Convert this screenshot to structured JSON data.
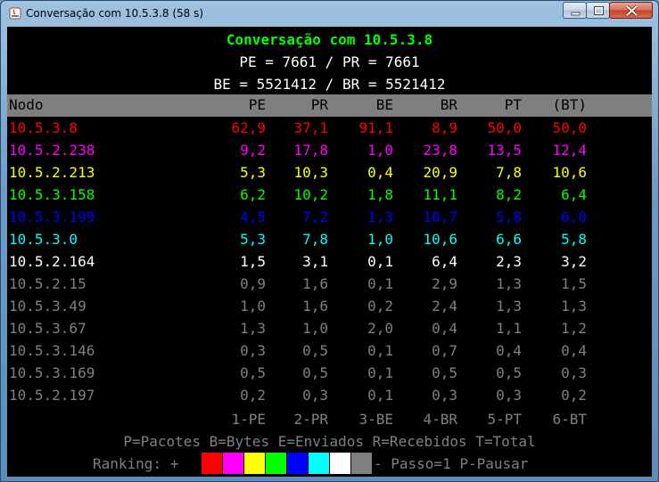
{
  "window": {
    "title": "Conversação com 10.5.3.8 (58 s)"
  },
  "summary": {
    "heading": "Conversação com 10.5.3.8",
    "packets_line": "PE = 7661 / PR = 7661",
    "bytes_line": "BE = 5521412 / BR = 5521412"
  },
  "table": {
    "columns": [
      "Nodo",
      "PE",
      "PR",
      "BE",
      "BR",
      "PT",
      "(BT)"
    ],
    "rows": [
      {
        "node": "10.5.3.8",
        "pe": "62,9",
        "pr": "37,1",
        "be": "91,1",
        "br": "8,9",
        "pt": "50,0",
        "bt": "50,0",
        "color": "#ff0000"
      },
      {
        "node": "10.5.2.238",
        "pe": "9,2",
        "pr": "17,8",
        "be": "1,0",
        "br": "23,8",
        "pt": "13,5",
        "bt": "12,4",
        "color": "#ff00ff"
      },
      {
        "node": "10.5.2.213",
        "pe": "5,3",
        "pr": "10,3",
        "be": "0,4",
        "br": "20,9",
        "pt": "7,8",
        "bt": "10,6",
        "color": "#ffff00"
      },
      {
        "node": "10.5.3.158",
        "pe": "6,2",
        "pr": "10,2",
        "be": "1,8",
        "br": "11,1",
        "pt": "8,2",
        "bt": "6,4",
        "color": "#00ff00"
      },
      {
        "node": "10.5.3.199",
        "pe": "4,5",
        "pr": "7,2",
        "be": "1,3",
        "br": "10,7",
        "pt": "5,8",
        "bt": "6,0",
        "color": "#0000ff"
      },
      {
        "node": "10.5.3.0",
        "pe": "5,3",
        "pr": "7,8",
        "be": "1,0",
        "br": "10,6",
        "pt": "6,6",
        "bt": "5,8",
        "color": "#00ffff"
      },
      {
        "node": "10.5.2.164",
        "pe": "1,5",
        "pr": "3,1",
        "be": "0,1",
        "br": "6,4",
        "pt": "2,3",
        "bt": "3,2",
        "color": "#ffffff"
      },
      {
        "node": "10.5.2.15",
        "pe": "0,9",
        "pr": "1,6",
        "be": "0,1",
        "br": "2,9",
        "pt": "1,3",
        "bt": "1,5",
        "color": "#808080"
      },
      {
        "node": "10.5.3.49",
        "pe": "1,0",
        "pr": "1,6",
        "be": "0,2",
        "br": "2,4",
        "pt": "1,3",
        "bt": "1,3",
        "color": "#808080"
      },
      {
        "node": "10.5.3.67",
        "pe": "1,3",
        "pr": "1,0",
        "be": "2,0",
        "br": "0,4",
        "pt": "1,1",
        "bt": "1,2",
        "color": "#808080"
      },
      {
        "node": "10.5.3.146",
        "pe": "0,3",
        "pr": "0,5",
        "be": "0,1",
        "br": "0,7",
        "pt": "0,4",
        "bt": "0,4",
        "color": "#808080"
      },
      {
        "node": "10.5.3.169",
        "pe": "0,5",
        "pr": "0,5",
        "be": "0,1",
        "br": "0,5",
        "pt": "0,5",
        "bt": "0,3",
        "color": "#808080"
      },
      {
        "node": "10.5.2.197",
        "pe": "0,2",
        "pr": "0,3",
        "be": "0,1",
        "br": "0,3",
        "pt": "0,3",
        "bt": "0,2",
        "color": "#808080"
      }
    ],
    "sort_keys": [
      "1-PE",
      "2-PR",
      "3-BE",
      "4-BR",
      "5-PT",
      "6-BT"
    ]
  },
  "footer": {
    "legend_text": "P=Pacotes B=Bytes E=Enviados R=Recebidos T=Total",
    "ranking_prefix": "Ranking: +",
    "ranking_suffix": "- Passo=1 P-Pausar",
    "ranking_colors": [
      "#ff0000",
      "#ff00ff",
      "#ffff00",
      "#00ff00",
      "#0000ff",
      "#00ffff",
      "#ffffff",
      "#808080"
    ]
  },
  "colors": {
    "heading": "#00ff00",
    "text": "#ffffff",
    "header_bg": "#7f7f7f",
    "muted": "#808080"
  }
}
